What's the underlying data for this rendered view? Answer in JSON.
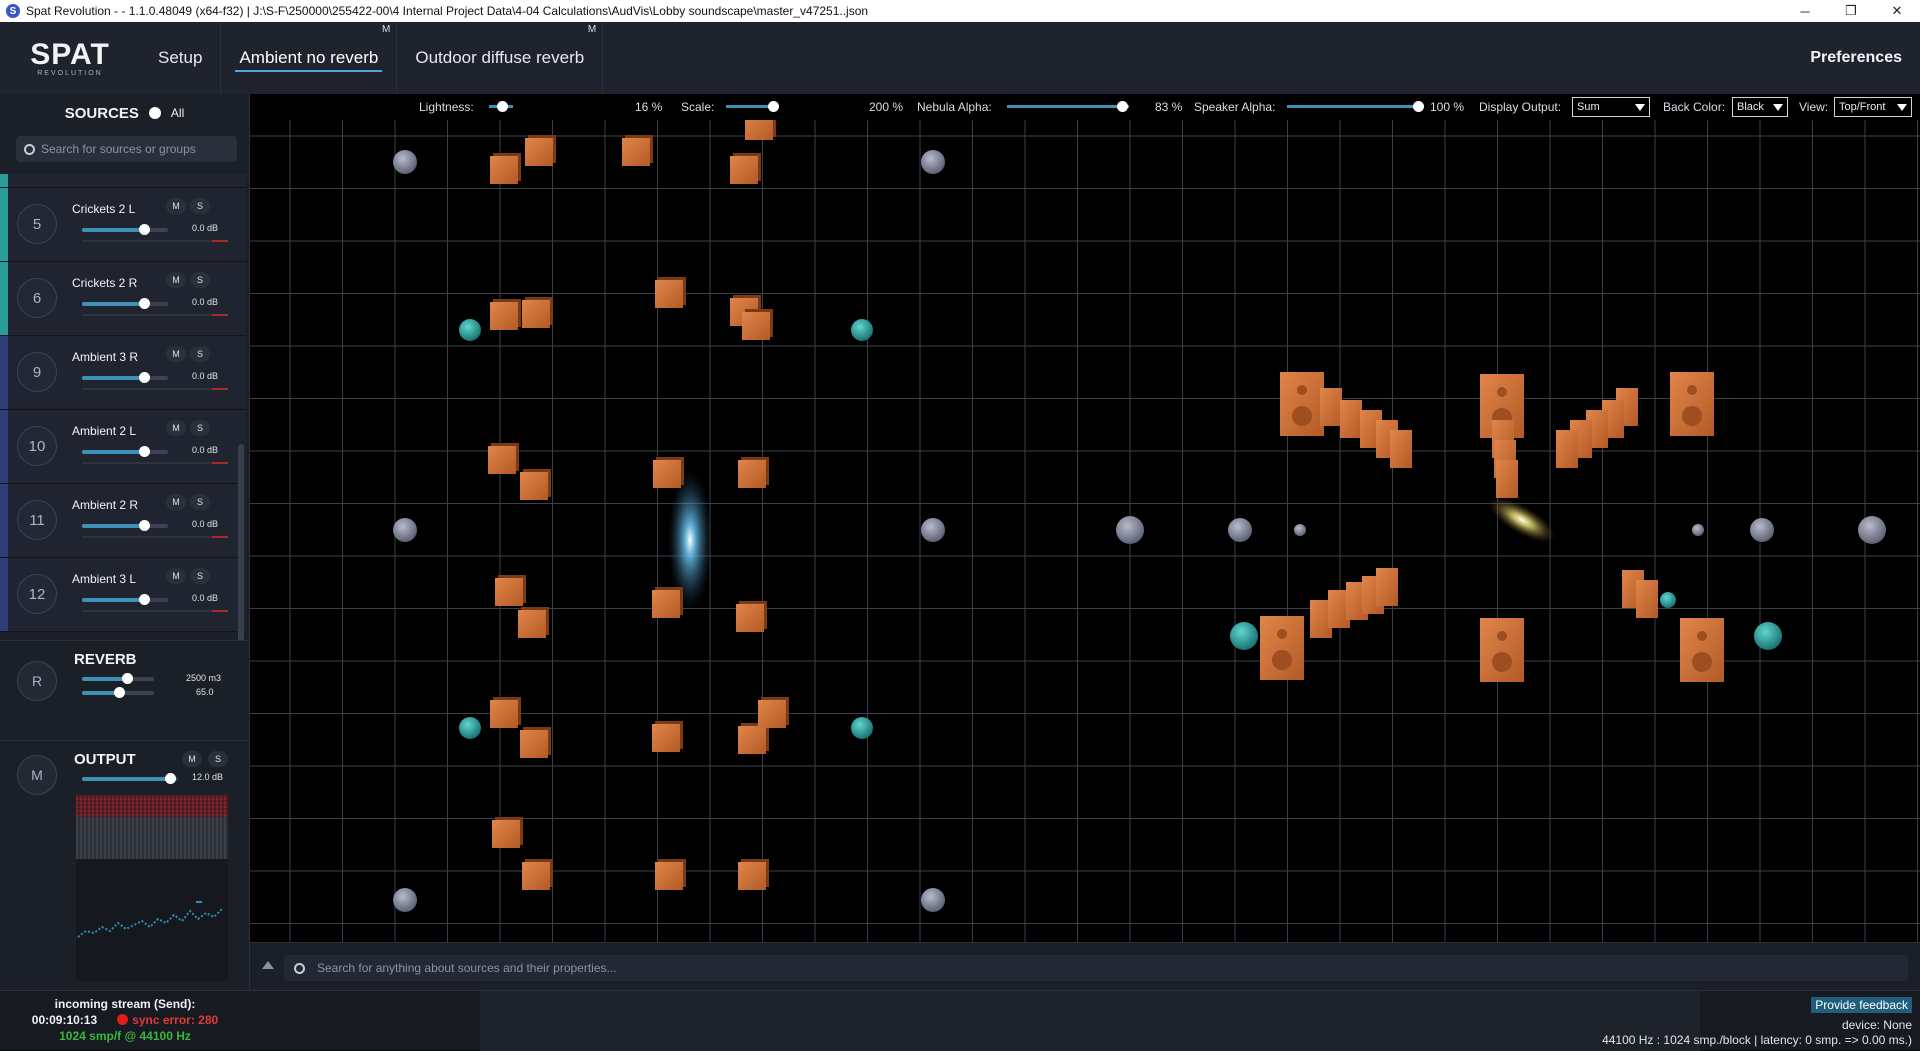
{
  "window": {
    "title": "Spat Revolution -  - 1.1.0.48049 (x64-f32) | J:\\S-F\\250000\\255422-00\\4 Internal Project Data\\4-04 Calculations\\AudVis\\Lobby soundscape\\master_v47251..json",
    "app_icon": "S",
    "minimize": "─",
    "maximize": "❐",
    "close": "✕"
  },
  "logo": {
    "main": "SPAT",
    "sub": "REVOLUTION"
  },
  "menu": {
    "items": [
      {
        "label": "Setup",
        "badge": ""
      },
      {
        "label": "Ambient no reverb",
        "badge": "M"
      },
      {
        "label": "Outdoor diffuse reverb",
        "badge": "M"
      }
    ],
    "preferences": "Preferences"
  },
  "sources": {
    "title": "SOURCES",
    "filter": "All",
    "search_placeholder": "Search for sources or groups",
    "items": [
      {
        "number": "5",
        "name": "Crickets 2 L",
        "mute": "M",
        "solo": "S",
        "gain": "0.0 dB",
        "level": 0.72,
        "stripe": "#2a9d9a"
      },
      {
        "number": "6",
        "name": "Crickets 2 R",
        "mute": "M",
        "solo": "S",
        "gain": "0.0 dB",
        "level": 0.72,
        "stripe": "#2a9d9a"
      },
      {
        "number": "9",
        "name": "Ambient 3 R",
        "mute": "M",
        "solo": "S",
        "gain": "0.0 dB",
        "level": 0.72,
        "stripe": "#2f3e78"
      },
      {
        "number": "10",
        "name": "Ambient 2 L",
        "mute": "M",
        "solo": "S",
        "gain": "0.0 dB",
        "level": 0.72,
        "stripe": "#2f3e78"
      },
      {
        "number": "11",
        "name": "Ambient 2 R",
        "mute": "M",
        "solo": "S",
        "gain": "0.0 dB",
        "level": 0.72,
        "stripe": "#2f3e78"
      },
      {
        "number": "12",
        "name": "Ambient 3 L",
        "mute": "M",
        "solo": "S",
        "gain": "0.0 dB",
        "level": 0.72,
        "stripe": "#2f3e78"
      }
    ]
  },
  "reverb": {
    "letter": "R",
    "title": "REVERB",
    "room_volume": "2500 m3",
    "value2": "65.0",
    "level1": 0.62,
    "level2": 0.52
  },
  "output": {
    "letter": "M",
    "title": "OUTPUT",
    "mute": "M",
    "solo": "S",
    "gain": "12.0 dB",
    "level": 0.92
  },
  "toolbar": {
    "lightness_label": "Lightness:",
    "lightness_value": "16 %",
    "lightness_level": 0.16,
    "scale_label": "Scale:",
    "scale_value": "200 %",
    "scale_level": 0.5,
    "nebula_label": "Nebula Alpha:",
    "nebula_value": "83 %",
    "nebula_level": 0.83,
    "speaker_label": "Speaker Alpha:",
    "speaker_value": "100 %",
    "speaker_level": 1.0,
    "display_output_label": "Display Output:",
    "display_output_value": "Sum",
    "back_color_label": "Back Color:",
    "back_color_value": "Black",
    "view_label": "View:",
    "view_value": "Top/Front"
  },
  "search": {
    "placeholder": "Search for anything about sources and their properties..."
  },
  "status": {
    "stream_title": "incoming stream (Send):",
    "timecode": "00:09:10:13",
    "sync_error": "sync error: 280",
    "buffer": "1024 smp/f @ 44100 Hz",
    "feedback": "Provide feedback",
    "device": "device: None",
    "rate": "44100 Hz : 1024 smp./block | latency: 0 smp. => 0.00 ms.)"
  },
  "colors": {
    "accent": "#3d91b7",
    "speaker": "#c8682f",
    "source_sphere": "#2aa7a3",
    "grid": "#3a3f48"
  }
}
